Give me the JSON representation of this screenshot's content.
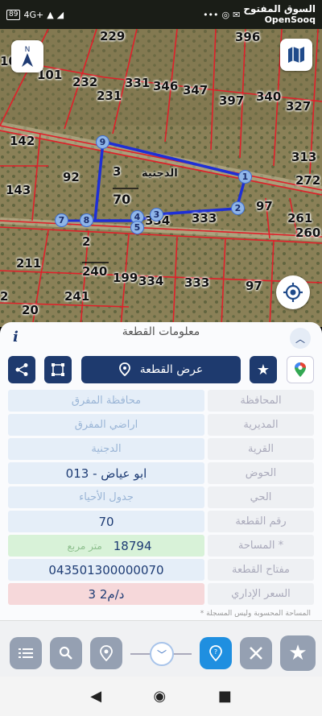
{
  "status_bar": {
    "battery": "89",
    "network": "4G+",
    "brand_arabic": "السوق المفتوح",
    "brand_english": "OpenSooq"
  },
  "map": {
    "plot_numbers": [
      "229",
      "396",
      "10",
      "101",
      "232",
      "331",
      "346",
      "347",
      "231",
      "397",
      "340",
      "327",
      "142",
      "313",
      "272",
      "92",
      "143",
      "97",
      "261",
      "260",
      "2",
      "211",
      "199",
      "334",
      "333",
      "97",
      "241",
      "2",
      "20"
    ],
    "selected_parcel": {
      "name": "الدجنية",
      "basin": "3",
      "plot": "70",
      "plot2": "334",
      "plot3": "333",
      "plot4": "240"
    },
    "vertices": [
      "1",
      "2",
      "3",
      "4",
      "5",
      "7",
      "8",
      "9"
    ],
    "compass_label": "N",
    "colors": {
      "boundary": "#e0202a",
      "parcel_outline": "#1e2fd6",
      "vertex_fill": "#8fb5e8"
    }
  },
  "panel": {
    "title": "معلومات القطعة",
    "info_glyph": "i",
    "show_parcel_label": "عرض القطعة",
    "fields": [
      {
        "label": "المحافظة",
        "value": "محافظة المفرق",
        "style": "light"
      },
      {
        "label": "المديرية",
        "value": "اراضي المفرق",
        "style": "light"
      },
      {
        "label": "القرية",
        "value": "الدجنية",
        "style": "light"
      },
      {
        "label": "الحوض",
        "value": "ابو عياض - 013",
        "style": "dark"
      },
      {
        "label": "الحي",
        "value": "جدول الأحياء",
        "style": "light"
      },
      {
        "label": "رقم القطعة",
        "value": "70",
        "style": "dark"
      },
      {
        "label": "المساحة *",
        "value": "18794",
        "unit": "متر مربع",
        "style": "green"
      },
      {
        "label": "مفتاح القطعة",
        "value": "043501300000070",
        "style": "dark"
      },
      {
        "label": "السعر الإداري",
        "value": "3 د/م2",
        "style": "red"
      }
    ],
    "note": "* المساحة المحسوبة وليس المسجلة"
  },
  "toolbar": {
    "icons": [
      "list-icon",
      "search-icon",
      "location-pin-icon",
      "chevron-down-icon",
      "help-pin-icon",
      "measure-tools-icon",
      "star-icon"
    ]
  }
}
